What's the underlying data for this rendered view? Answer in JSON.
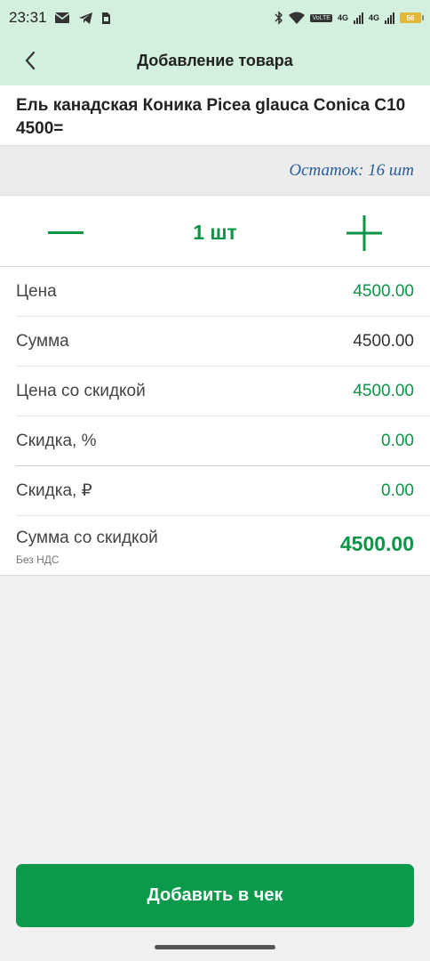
{
  "status": {
    "time": "23:31",
    "volte_label": "VoLTE",
    "net_label_1": "4G",
    "net_label_2": "4G",
    "battery": "56",
    "icons": [
      "mail-icon",
      "telegram-icon",
      "sim-icon",
      "bluetooth-icon",
      "wifi-icon",
      "signal-icon",
      "battery-icon"
    ]
  },
  "appbar": {
    "title": "Добавление товара"
  },
  "product": {
    "name": "Ель канадская Коника Picea glauca Conica С10 4500="
  },
  "stock": {
    "text": "Остаток: 16 шт"
  },
  "quantity": {
    "value": "1 шт"
  },
  "details": {
    "price": {
      "label": "Цена",
      "value": "4500.00"
    },
    "sum": {
      "label": "Сумма",
      "value": "4500.00"
    },
    "discount_price": {
      "label": "Цена со скидкой",
      "value": "4500.00"
    },
    "discount_pct": {
      "label": "Скидка, %",
      "value": "0.00"
    },
    "discount_rub": {
      "label": "Скидка, ₽",
      "value": "0.00"
    },
    "total": {
      "label": "Сумма со скидкой",
      "sublabel": "Без НДС",
      "value": "4500.00"
    }
  },
  "actions": {
    "add_label": "Добавить в чек"
  },
  "colors": {
    "accent": "#0b9a4c",
    "header_bg": "#d3efdd",
    "stock_text": "#2a5d9a"
  }
}
